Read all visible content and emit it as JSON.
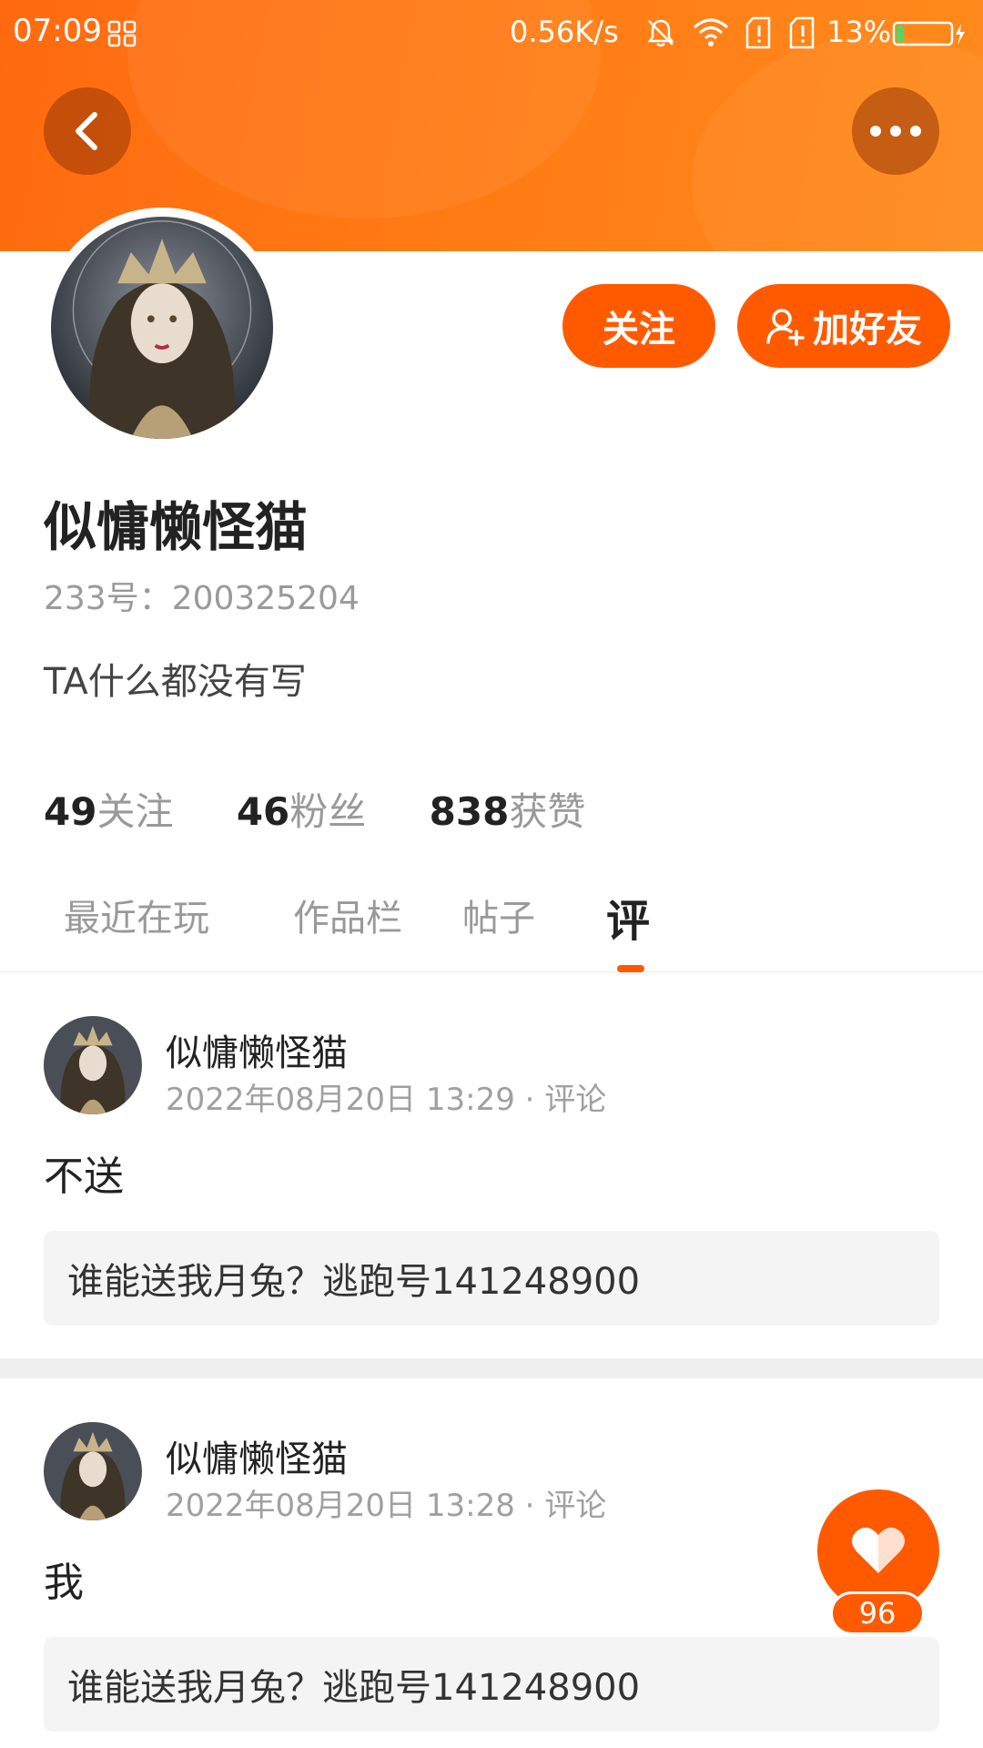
{
  "status_bar": {
    "time": "07:09",
    "network_speed": "0.56K/s",
    "battery_percent": "13%",
    "battery_level": 0.13,
    "icons": [
      "apps-icon",
      "bell-muted-icon",
      "wifi-icon",
      "sim-card-icon",
      "sim-card-icon",
      "battery-charging-icon"
    ]
  },
  "nav": {
    "back_icon": "chevron-left-icon",
    "more_icon": "more-dots-icon"
  },
  "actions": {
    "follow_label": "关注",
    "add_friend_label": "加好友",
    "add_friend_icon": "add-user-icon"
  },
  "profile": {
    "name": "似慵懒怪猫",
    "uid": "233号：200325204",
    "bio": "TA什么都没有写"
  },
  "stats": [
    {
      "value": "49",
      "label": "关注"
    },
    {
      "value": "46",
      "label": "粉丝"
    },
    {
      "value": "838",
      "label": "获赞"
    }
  ],
  "tabs": [
    {
      "label": "最近在玩"
    },
    {
      "label": "作品栏"
    },
    {
      "label": "帖子"
    },
    {
      "label": "评"
    }
  ],
  "active_tab": "评",
  "posts": [
    {
      "author": "似慵懒怪猫",
      "meta": "2022年08月20日 13:29 · 评论",
      "content": "不送",
      "quote": "谁能送我月兔？逃跑号141248900"
    },
    {
      "author": "似慵懒怪猫",
      "meta": "2022年08月20日 13:28 · 评论",
      "content": "我",
      "quote": "谁能送我月兔？逃跑号141248900"
    }
  ],
  "like": {
    "count": "96",
    "icon": "heart-icon"
  },
  "colors": {
    "accent": "#ff5a00",
    "header_gradient_start": "#ff6a10",
    "header_gradient_end": "#ff8a1c"
  }
}
